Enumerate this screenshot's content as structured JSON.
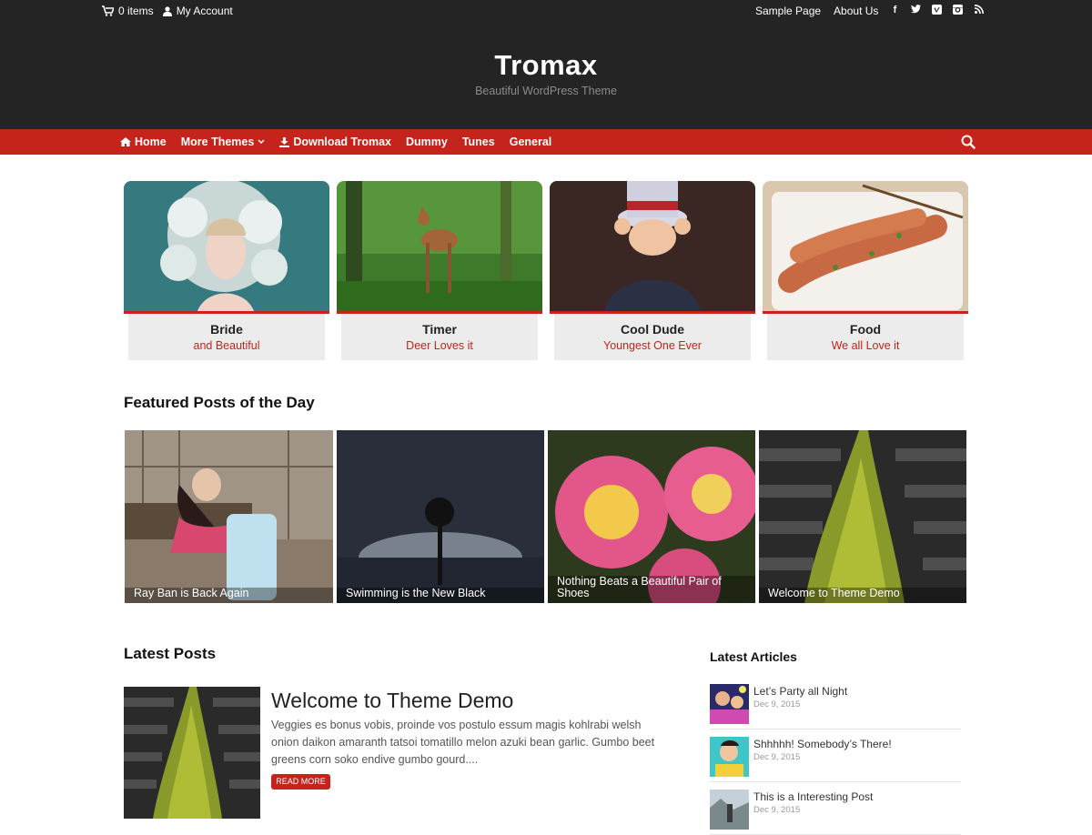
{
  "topbar": {
    "cart_label": "0 items",
    "account_label": "My Account",
    "links": [
      "Sample Page",
      "About Us"
    ],
    "social_icons": [
      "facebook-icon",
      "twitter-icon",
      "vimeo-icon",
      "instagram-icon",
      "rss-icon"
    ]
  },
  "header": {
    "title": "Tromax",
    "description": "Beautiful WordPress Theme"
  },
  "nav": {
    "items": [
      "Home",
      "More Themes",
      "Download Tromax",
      "Dummy",
      "Tunes",
      "General"
    ]
  },
  "features": [
    {
      "title": "Bride",
      "subtitle": "and Beautiful"
    },
    {
      "title": "Timer",
      "subtitle": "Deer Loves it"
    },
    {
      "title": "Cool Dude",
      "subtitle": "Youngest One Ever"
    },
    {
      "title": "Food",
      "subtitle": "We all Love it"
    }
  ],
  "featured": {
    "heading": "Featured Posts of the Day",
    "posts": [
      {
        "title": "Ray Ban is Back Again"
      },
      {
        "title": "Swimming is the New Black"
      },
      {
        "title": "Nothing Beats a Beautiful Pair of Shoes"
      },
      {
        "title": "Welcome to Theme Demo"
      }
    ]
  },
  "latest": {
    "heading": "Latest Posts",
    "post": {
      "title": "Welcome to Theme Demo",
      "excerpt": "Veggies es bonus vobis, proinde vos postulo essum magis kohlrabi welsh onion daikon amaranth tatsoi tomatillo melon azuki bean garlic. Gumbo beet greens corn soko endive gumbo gourd....",
      "button": "READ MORE"
    }
  },
  "sidebar": {
    "heading": "Latest Articles",
    "articles": [
      {
        "title": "Let’s Party all Night",
        "date": "Dec 9, 2015"
      },
      {
        "title": "Shhhhh! Somebody’s There!",
        "date": "Dec 9, 2015"
      },
      {
        "title": "This is a Interesting Post",
        "date": "Dec 9, 2015"
      }
    ]
  },
  "colors": {
    "accent": "#c4241b",
    "header_bg": "#242424",
    "caption_bg": "#ececec"
  }
}
